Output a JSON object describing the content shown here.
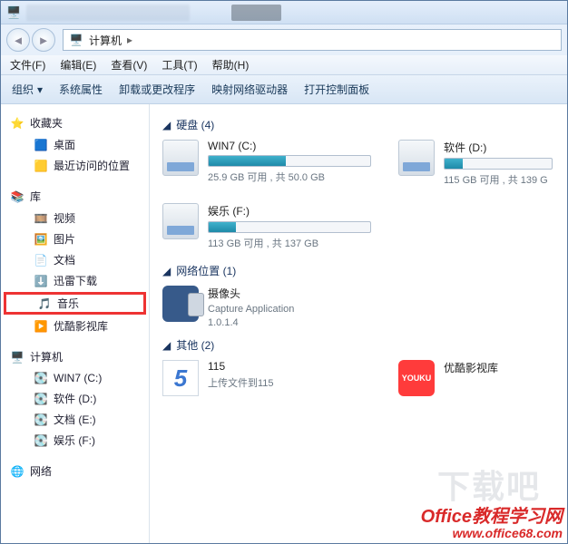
{
  "titlebar": {
    "icon_alt": "computer"
  },
  "address": {
    "root": "计算机",
    "sep": "▸",
    "pc_icon": "computer-icon",
    "dropdown": "▾"
  },
  "menus": [
    "文件(F)",
    "编辑(E)",
    "查看(V)",
    "工具(T)",
    "帮助(H)"
  ],
  "toolbar": {
    "organize": "组织",
    "items": [
      "系统属性",
      "卸载或更改程序",
      "映射网络驱动器",
      "打开控制面板"
    ]
  },
  "sidebar": {
    "favorites": {
      "label": "收藏夹",
      "items": [
        "桌面",
        "最近访问的位置"
      ]
    },
    "libraries": {
      "label": "库",
      "items": [
        "视频",
        "图片",
        "文档",
        "迅雷下载",
        "音乐",
        "优酷影视库"
      ]
    },
    "computer": {
      "label": "计算机",
      "items": [
        "WIN7 (C:)",
        "软件 (D:)",
        "文档 (E:)",
        "娱乐 (F:)"
      ]
    },
    "network": {
      "label": "网络"
    }
  },
  "highlighted_item": "音乐",
  "main": {
    "disks": {
      "header": "硬盘 (4)",
      "drives": [
        {
          "name": "WIN7 (C:)",
          "sub": "25.9 GB 可用 , 共 50.0 GB",
          "fill": 48
        },
        {
          "name": "软件 (D:)",
          "sub": "115 GB 可用 , 共 139 G",
          "fill": 17
        },
        {
          "name": "娱乐 (F:)",
          "sub": "113 GB 可用 , 共 137 GB",
          "fill": 17
        }
      ]
    },
    "netloc": {
      "header": "网络位置 (1)",
      "items": [
        {
          "title": "摄像头",
          "sub1": "Capture Application",
          "sub2": "1.0.1.4"
        }
      ]
    },
    "other": {
      "header": "其他 (2)",
      "items": [
        {
          "title": "115",
          "sub": "上传文件到115",
          "icon": "115"
        },
        {
          "title": "优酷影视库",
          "sub": "",
          "icon": "youku"
        }
      ]
    }
  },
  "watermark": {
    "line1": "Office教程学习网",
    "line2": "www.office68.com"
  },
  "bg_watermark": "下载吧"
}
